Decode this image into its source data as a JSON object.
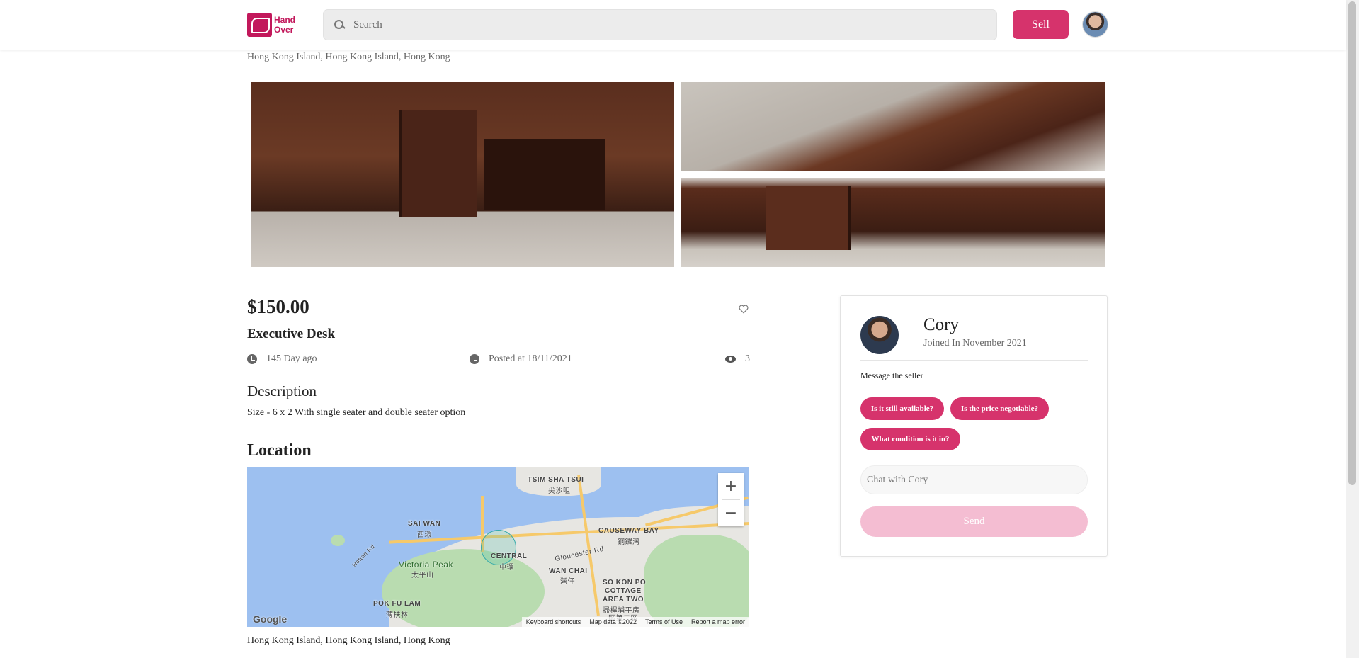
{
  "header": {
    "logo_text": [
      "Hand",
      "Over"
    ],
    "search_placeholder": "Search",
    "sell_label": "Sell"
  },
  "listing": {
    "location_top": "Hong Kong Island, Hong Kong Island, Hong Kong",
    "price": "$150.00",
    "title": "Executive Desk",
    "age": "145 Day ago",
    "posted": "Posted at 18/11/2021",
    "views": "3",
    "description_heading": "Description",
    "description": "Size - 6 x 2 With single seater and double seater option",
    "location_heading": "Location",
    "location_bottom": "Hong Kong Island, Hong Kong Island, Hong Kong"
  },
  "map": {
    "labels": {
      "tsim_sha_tsui": "TSIM SHA TSUI",
      "tsim_sha_tsui_zh": "尖沙咀",
      "sai_wan": "SAI WAN",
      "sai_wan_zh": "西環",
      "central": "CENTRAL",
      "central_zh": "中環",
      "causeway_bay": "CAUSEWAY BAY",
      "causeway_bay_zh": "銅鑼灣",
      "victoria_peak": "Victoria Peak",
      "victoria_peak_zh": "太平山",
      "wan_chai": "WAN CHAI",
      "wan_chai_zh": "灣仔",
      "so_kon_po": "SO KON PO",
      "cottage_area_two": "COTTAGE",
      "area_two": "AREA TWO",
      "cottage_zh1": "掃桿埔平房",
      "cottage_zh2": "區第二區",
      "pok_fu_lam": "POK FU LAM",
      "pok_fu_lam_zh": "薄扶林",
      "gloucester_rd": "Gloucester Rd",
      "hatton_rd": "Hatton Rd"
    },
    "zoom_in": "+",
    "zoom_out": "−",
    "google": "Google",
    "footer": {
      "shortcuts": "Keyboard shortcuts",
      "data": "Map data ©2022",
      "terms": "Terms of Use",
      "report": "Report a map error"
    }
  },
  "seller": {
    "name": "Cory",
    "joined": "Joined In November 2021",
    "message_label": "Message the seller",
    "quick_replies": [
      "Is it still available?",
      "Is the price negotiable?",
      "What condition is it in?"
    ],
    "chat_placeholder": "Chat with Cory",
    "send_label": "Send"
  },
  "colors": {
    "accent": "#d6336c",
    "accent_disabled": "#f4bdd2"
  }
}
